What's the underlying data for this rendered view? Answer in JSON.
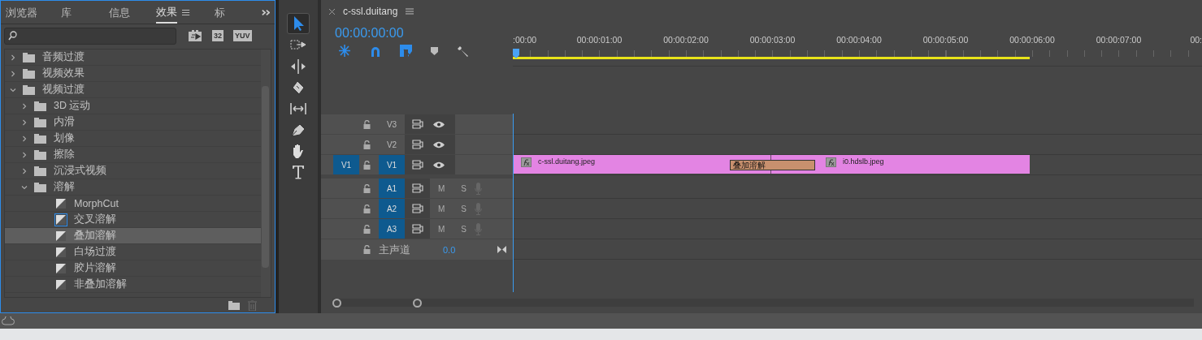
{
  "effects_panel": {
    "tabs": [
      {
        "label": "浏览器",
        "selected": false
      },
      {
        "label": "库",
        "selected": false
      },
      {
        "label": "信息",
        "selected": false
      },
      {
        "label": "效果",
        "selected": true
      },
      {
        "label": "标",
        "selected": false
      }
    ],
    "filters": [
      {
        "kind": "accelerated"
      },
      {
        "kind": "badge",
        "label": "32"
      },
      {
        "kind": "badge",
        "label": "YUV"
      }
    ],
    "tree": [
      {
        "kind": "folder",
        "label": "音频过渡",
        "expanded": false,
        "selected": false
      },
      {
        "kind": "folder",
        "label": "视频效果",
        "expanded": false,
        "selected": false
      },
      {
        "kind": "folder",
        "label": "视频过渡",
        "expanded": true,
        "selected": false,
        "children": [
          {
            "kind": "folder",
            "label": "3D 运动",
            "expanded": false,
            "selected": false
          },
          {
            "kind": "folder",
            "label": "内滑",
            "expanded": false,
            "selected": false
          },
          {
            "kind": "folder",
            "label": "划像",
            "expanded": false,
            "selected": false
          },
          {
            "kind": "folder",
            "label": "擦除",
            "expanded": false,
            "selected": false
          },
          {
            "kind": "folder",
            "label": "沉浸式视频",
            "expanded": false,
            "selected": false
          },
          {
            "kind": "folder",
            "label": "溶解",
            "expanded": true,
            "selected": false,
            "children": [
              {
                "kind": "effect",
                "label": "MorphCut",
                "default": false,
                "selected": false
              },
              {
                "kind": "effect",
                "label": "交叉溶解",
                "default": true,
                "selected": false
              },
              {
                "kind": "effect",
                "label": "叠加溶解",
                "default": false,
                "selected": true
              },
              {
                "kind": "effect",
                "label": "白场过渡",
                "default": false,
                "selected": false
              },
              {
                "kind": "effect",
                "label": "胶片溶解",
                "default": false,
                "selected": false
              },
              {
                "kind": "effect",
                "label": "非叠加溶解",
                "default": false,
                "selected": false
              }
            ]
          }
        ]
      }
    ]
  },
  "tools": [
    {
      "kind": "select",
      "selected": true
    },
    {
      "kind": "track-select",
      "selected": false
    },
    {
      "kind": "ripple",
      "selected": false
    },
    {
      "kind": "razor",
      "selected": false
    },
    {
      "kind": "slip",
      "selected": false
    },
    {
      "kind": "pen",
      "selected": false
    },
    {
      "kind": "hand",
      "selected": false
    },
    {
      "kind": "type",
      "selected": false
    }
  ],
  "timeline": {
    "tab": "c-ssl.duitang",
    "timecode": "00:00:00:00",
    "ruler": [
      ":00:00",
      "00:00:01:00",
      "00:00:02:00",
      "00:00:03:00",
      "00:00:04:00",
      "00:00:05:00",
      "00:00:06:00",
      "00:00:07:00",
      "00:"
    ],
    "tracks": [
      {
        "kind": "video",
        "label": "V3",
        "targeted": false
      },
      {
        "kind": "video",
        "label": "V2",
        "targeted": false
      },
      {
        "kind": "video",
        "label": "V1",
        "targeted": true,
        "source": "V1",
        "clips": [
          {
            "name": "c-ssl.duitang.jpeg"
          },
          {
            "name": "i0.hdslb.jpeg"
          }
        ],
        "transition": "叠加溶解"
      },
      {
        "kind": "audio",
        "label": "A1",
        "targeted": true,
        "mute": "M",
        "solo": "S"
      },
      {
        "kind": "audio",
        "label": "A2",
        "targeted": true,
        "mute": "M",
        "solo": "S"
      },
      {
        "kind": "audio",
        "label": "A3",
        "targeted": true,
        "mute": "M",
        "solo": "S"
      },
      {
        "kind": "master",
        "label": "主声道",
        "value": "0.0"
      }
    ]
  }
}
